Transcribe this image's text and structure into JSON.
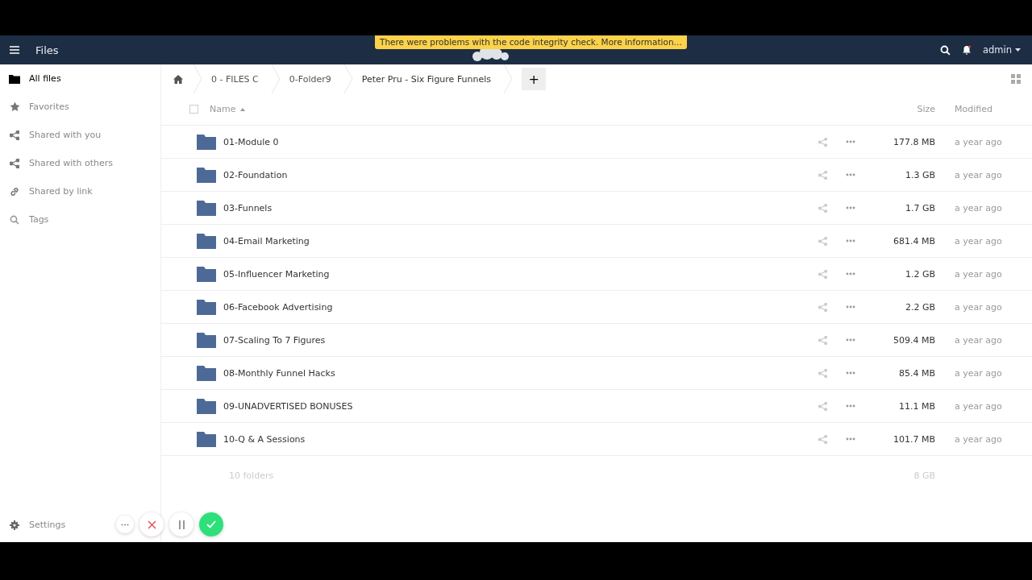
{
  "app": {
    "title": "Files",
    "notice": "There were problems with the code integrity check. More information…",
    "user": "admin"
  },
  "sidebar": {
    "items": [
      {
        "label": "All files",
        "kind": "folder",
        "selected": true
      },
      {
        "label": "Favorites",
        "kind": "star",
        "selected": false
      },
      {
        "label": "Shared with you",
        "kind": "share",
        "selected": false
      },
      {
        "label": "Shared with others",
        "kind": "share",
        "selected": false
      },
      {
        "label": "Shared by link",
        "kind": "link",
        "selected": false
      },
      {
        "label": "Tags",
        "kind": "search",
        "selected": false
      }
    ],
    "settings": "Settings"
  },
  "breadcrumbs": [
    "0 - FILES C",
    "0-Folder9",
    "Peter Pru - Six Figure Funnels"
  ],
  "new_button": "+",
  "table": {
    "select_all": {
      "checked": false
    },
    "columns": {
      "name": "Name",
      "size": "Size",
      "modified": "Modified"
    },
    "rows": [
      {
        "name": "01-Module 0",
        "size": "177.8 MB",
        "modified": "a year ago"
      },
      {
        "name": "02-Foundation",
        "size": "1.3 GB",
        "modified": "a year ago"
      },
      {
        "name": "03-Funnels",
        "size": "1.7 GB",
        "modified": "a year ago"
      },
      {
        "name": "04-Email Marketing",
        "size": "681.4 MB",
        "modified": "a year ago"
      },
      {
        "name": "05-Influencer Marketing",
        "size": "1.2 GB",
        "modified": "a year ago"
      },
      {
        "name": "06-Facebook Advertising",
        "size": "2.2 GB",
        "modified": "a year ago"
      },
      {
        "name": "07-Scaling To 7 Figures",
        "size": "509.4 MB",
        "modified": "a year ago"
      },
      {
        "name": "08-Monthly Funnel Hacks",
        "size": "85.4 MB",
        "modified": "a year ago"
      },
      {
        "name": "09-UNADVERTISED BONUSES",
        "size": "11.1 MB",
        "modified": "a year ago"
      },
      {
        "name": "10-Q & A Sessions",
        "size": "101.7 MB",
        "modified": "a year ago"
      }
    ],
    "summary": {
      "count": "10 folders",
      "size": "8 GB"
    }
  }
}
